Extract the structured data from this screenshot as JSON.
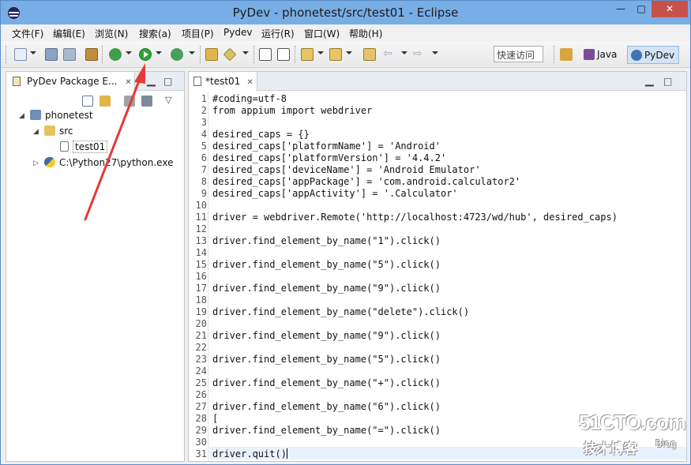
{
  "window": {
    "title": "PyDev - phonetest/src/test01 - Eclipse",
    "minimize": "—",
    "maximize": "□",
    "close": "✕"
  },
  "menu": [
    "文件(F)",
    "编辑(E)",
    "浏览(N)",
    "搜索(a)",
    "项目(P)",
    "Pydev",
    "运行(R)",
    "窗口(W)",
    "帮助(H)"
  ],
  "toolbar": {
    "quick_access": "快速访问",
    "perspective_java": "Java",
    "perspective_pydev": "PyDev"
  },
  "package_explorer": {
    "tab_label": "PyDev Package E...",
    "tree": [
      {
        "label": "phonetest",
        "level": 0,
        "expanded": true,
        "icon": "project-icon"
      },
      {
        "label": "src",
        "level": 1,
        "expanded": true,
        "icon": "folder-icon"
      },
      {
        "label": "test01",
        "level": 2,
        "icon": "file-icon"
      },
      {
        "label": "C:\\Python27\\python.exe",
        "level": 1,
        "expanded": false,
        "icon": "python-icon"
      }
    ]
  },
  "editor": {
    "tab_label": "*test01",
    "lines": [
      "#coding=utf-8",
      "from appium import webdriver",
      "",
      "desired_caps = {}",
      "desired_caps['platformName'] = 'Android'",
      "desired_caps['platformVersion'] = '4.4.2'",
      "desired_caps['deviceName'] = 'Android Emulator'",
      "desired_caps['appPackage'] = 'com.android.calculator2'",
      "desired_caps['appActivity'] = '.Calculator'",
      "",
      "driver = webdriver.Remote('http://localhost:4723/wd/hub', desired_caps)",
      "",
      "driver.find_element_by_name(\"1\").click()",
      "",
      "driver.find_element_by_name(\"5\").click()",
      "",
      "driver.find_element_by_name(\"9\").click()",
      "",
      "driver.find_element_by_name(\"delete\").click()",
      "",
      "driver.find_element_by_name(\"9\").click()",
      "",
      "driver.find_element_by_name(\"5\").click()",
      "",
      "driver.find_element_by_name(\"+\").click()",
      "",
      "driver.find_element_by_name(\"6\").click()",
      "[",
      "driver.find_element_by_name(\"=\").click()",
      "",
      "driver.quit()"
    ]
  },
  "watermark": {
    "main": "51CTO.com",
    "sub": "技术博客",
    "blog": "Blog"
  },
  "colors": {
    "title_bar": "#78aee6",
    "close_button": "#c7504a",
    "annotation_arrow": "#e53935"
  }
}
